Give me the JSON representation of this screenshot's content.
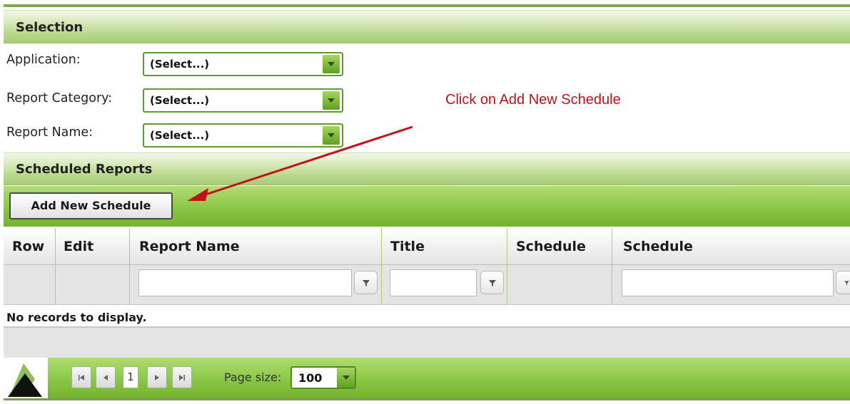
{
  "selection": {
    "title": "Selection",
    "fields": [
      {
        "label": "Application:",
        "value": "(Select...)"
      },
      {
        "label": "Report Category:",
        "value": "(Select...)"
      },
      {
        "label": "Report Name:",
        "value": "(Select...)"
      }
    ]
  },
  "annotation": {
    "text": "Click on Add New Schedule",
    "color": "#c1111b"
  },
  "scheduled_reports": {
    "title": "Scheduled Reports",
    "add_button_label": "Add New Schedule"
  },
  "grid": {
    "columns": [
      "Row",
      "Edit",
      "Report Name",
      "Title",
      "Schedule",
      "Schedule"
    ],
    "empty_message": "No records to display."
  },
  "pager": {
    "current_page": "1",
    "page_size_label": "Page size:",
    "page_size_value": "100"
  },
  "colors": {
    "accent_green": "#8ec94a",
    "border_green": "#5c9d2d",
    "annotation_red": "#c1111b"
  }
}
